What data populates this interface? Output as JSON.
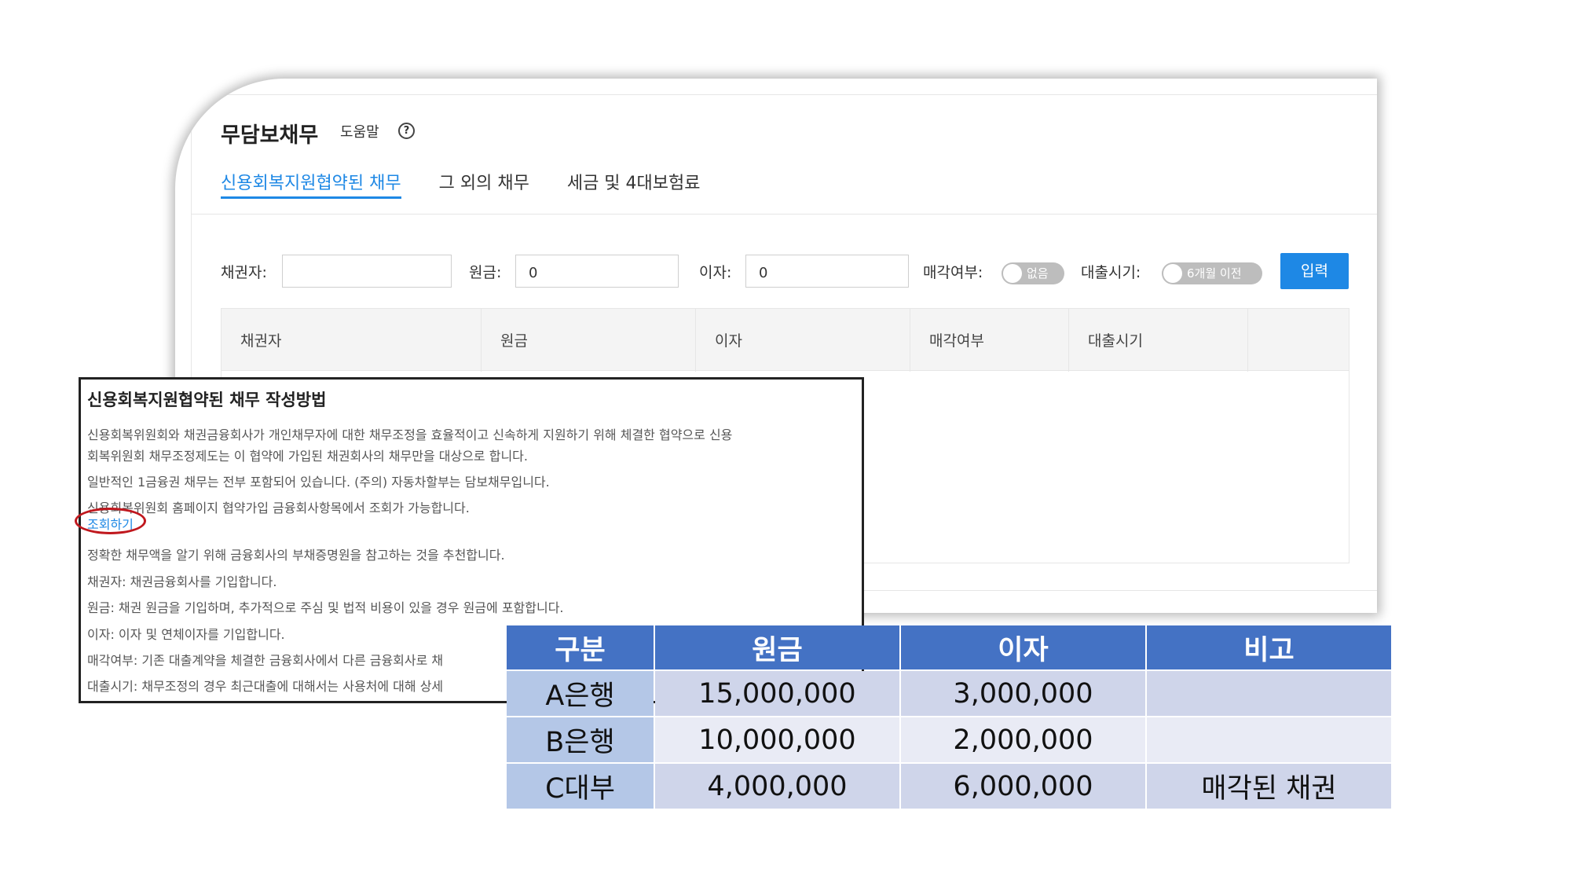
{
  "header": {
    "title": "무담보채무",
    "help_label": "도움말",
    "help_icon": "?"
  },
  "tabs": [
    {
      "label": "신용회복지원협약된 채무",
      "active": true
    },
    {
      "label": "그 외의 채무",
      "active": false
    },
    {
      "label": "세금 및 4대보험료",
      "active": false
    }
  ],
  "form": {
    "creditor_label": "채권자:",
    "creditor_value": "",
    "principal_label": "원금:",
    "principal_value": "0",
    "interest_label": "이자:",
    "interest_value": "0",
    "sold_label": "매각여부:",
    "sold_toggle": "없음",
    "loan_period_label": "대출시기:",
    "loan_period_toggle": "6개월 이전",
    "submit_label": "입력"
  },
  "grid": {
    "columns": [
      "채권자",
      "원금",
      "이자",
      "매각여부",
      "대출시기",
      ""
    ]
  },
  "help_panel": {
    "title": "신용회복지원협약된 채무 작성방법",
    "lines": [
      "신용회복위원회와 채권금융회사가 개인채무자에 대한 채무조정을 효율적이고 신속하게 지원하기 위해 체결한 협약으로 신용",
      "회복위원회 채무조정제도는 이 협약에 가입된 채권회사의 채무만을 대상으로 합니다.",
      "일반적인 1금융권 채무는 전부 포함되어 있습니다. (주의) 자동차할부는 담보채무입니다.",
      "신용회복위원회 홈페이지 협약가입 금융회사항목에서 조회가 가능합니다.",
      "정확한 채무액을 알기 위해 금융회사의 부채증명원을 참고하는 것을 추천합니다.",
      "채권자: 채권금융회사를 기입합니다.",
      "원금: 채권 원금을 기입하며, 추가적으로 주심 및 법적 비용이 있을 경우 원금에 포함합니다.",
      "이자: 이자 및 연체이자를 기입합니다.",
      "매각여부: 기존 대출계약을 체결한 금융회사에서 다른 금융회사로 채",
      "대출시기: 채무조정의 경우 최근대출에 대해서는 사용처에 대해 상세"
    ],
    "link_label": "조회하기"
  },
  "example_table": {
    "headers": [
      "구분",
      "원금",
      "이자",
      "비고"
    ],
    "rows": [
      [
        "A은행",
        "15,000,000",
        "3,000,000",
        ""
      ],
      [
        "B은행",
        "10,000,000",
        "2,000,000",
        ""
      ],
      [
        "C대부",
        "4,000,000",
        "6,000,000",
        "매각된 채권"
      ]
    ]
  },
  "colors": {
    "accent": "#1e88e5",
    "table_header": "#4472c4",
    "highlight_ellipse": "#c0181e"
  }
}
